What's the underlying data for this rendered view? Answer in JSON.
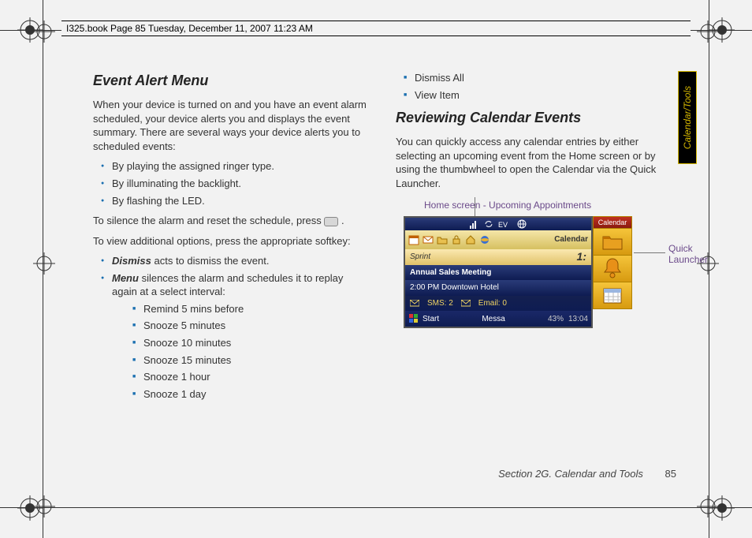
{
  "header": "I325.book  Page 85  Tuesday, December 11, 2007  11:23 AM",
  "side_tab": "Calendar/Tools",
  "footer_section": "Section 2G. Calendar and Tools",
  "footer_page": "85",
  "col1": {
    "heading": "Event Alert Menu",
    "p1": "When your device is turned on and you have an event alarm scheduled, your device alerts you and displays the event summary. There are several ways your device alerts you to scheduled events:",
    "alerts": [
      "By playing the assigned ringer type.",
      "By illuminating the backlight.",
      "By flashing the LED."
    ],
    "p2a": "To silence the alarm and reset the schedule, press ",
    "p2b": ".",
    "p3": "To view additional options, press the appropriate softkey:",
    "dismiss_label": "Dismiss",
    "dismiss_text": " acts to dismiss the event.",
    "menu_label": "Menu",
    "menu_text": " silences the alarm and schedules it to replay again at a select interval:",
    "snooze": [
      "Remind 5 mins before",
      "Snooze 5 minutes",
      "Snooze 10 minutes",
      "Snooze 15 minutes",
      "Snooze 1 hour",
      "Snooze 1 day"
    ]
  },
  "col2": {
    "top_items": [
      "Dismiss All",
      "View Item"
    ],
    "heading": "Reviewing Calendar Events",
    "p1": "You can quickly access any calendar entries by either selecting an upcoming event from the Home screen or by using the thumbwheel to open the Calendar via the Quick Launcher.",
    "caption": "Home screen - Upcoming Appointments",
    "callout": "Quick Launcher",
    "phone": {
      "carrier": "Sprint",
      "time_preview": "1:",
      "icons_row_calendar": "Calendar",
      "event_title": "Annual Sales Meeting",
      "event_sub": "2:00 PM Downtown Hotel",
      "sms": "SMS: 2",
      "email": "Email: 0",
      "start": "Start",
      "messa": "Messa",
      "batt": "43%",
      "clock": "13:04",
      "launcher_head": "Calendar"
    }
  }
}
